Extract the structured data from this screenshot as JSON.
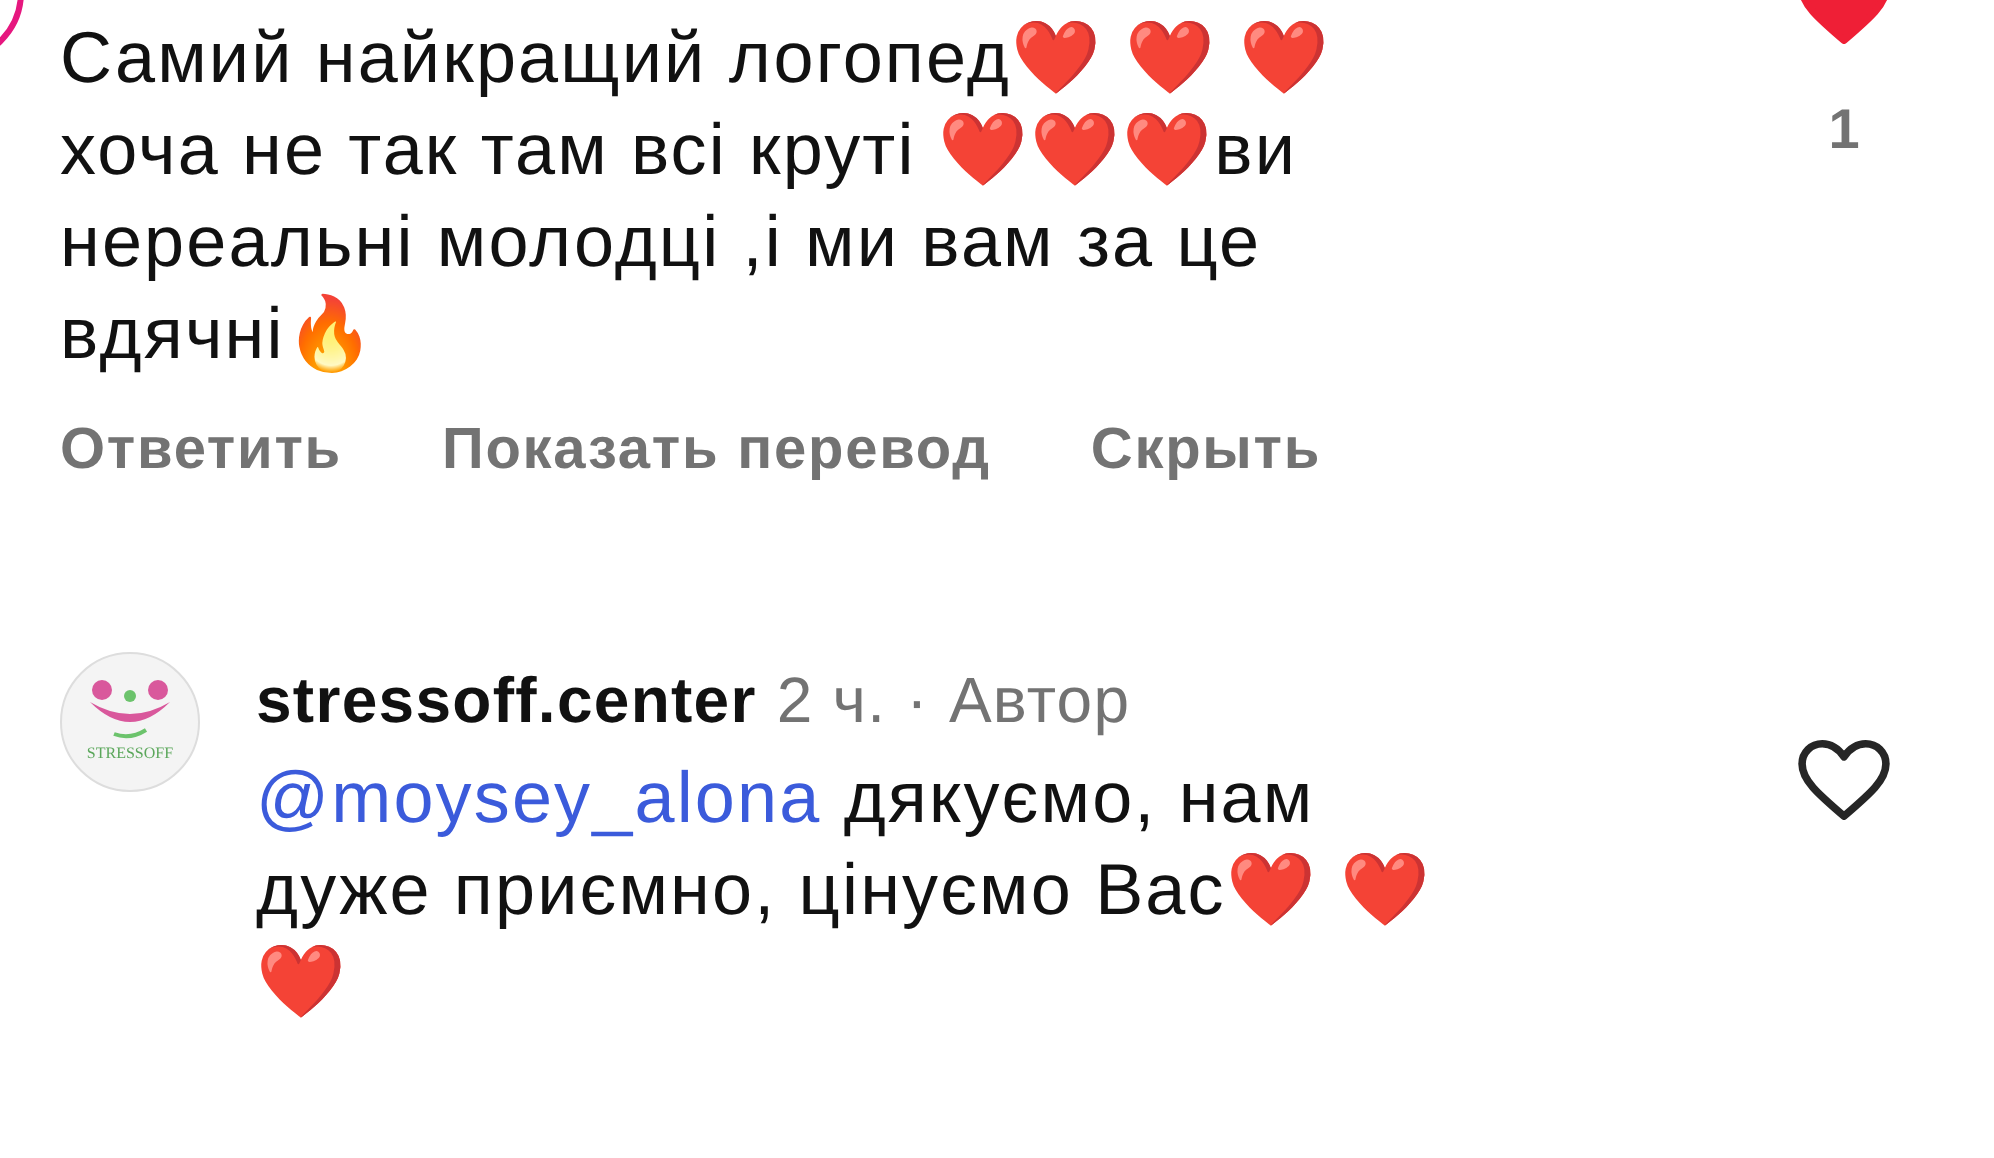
{
  "comment": {
    "lines": [
      [
        {
          "kind": "text",
          "text": "Самий найкращий логопед"
        },
        {
          "kind": "emoji",
          "text": "❤️ ❤️ ❤️"
        }
      ],
      [
        {
          "kind": "text",
          "text": "хоча не так там всі круті "
        },
        {
          "kind": "emoji",
          "text": "❤️❤️❤️"
        },
        {
          "kind": "text",
          "text": "ви"
        }
      ],
      [
        {
          "kind": "text",
          "text": "нереальні молодці ,і ми вам за це"
        }
      ],
      [
        {
          "kind": "text",
          "text": "вдячні"
        },
        {
          "kind": "emoji",
          "text": "🔥"
        }
      ]
    ],
    "liked": true,
    "like_count": "1",
    "actions": [
      "Ответить",
      "Показать перевод",
      "Скрыть"
    ]
  },
  "reply": {
    "avatar_text": "STRESSOFF",
    "username": "stressoff.center",
    "time": "2 ч.",
    "separator": "·",
    "badge": "Автор",
    "liked": false,
    "lines": [
      [
        {
          "kind": "mention",
          "text": "@moysey_alona"
        },
        {
          "kind": "text",
          "text": " дякуємо, нам"
        }
      ],
      [
        {
          "kind": "text",
          "text": "дуже приємно, цінуємо Вас"
        },
        {
          "kind": "emoji",
          "text": "❤️ ❤️"
        }
      ],
      [
        {
          "kind": "emoji",
          "text": "❤️"
        }
      ]
    ]
  }
}
